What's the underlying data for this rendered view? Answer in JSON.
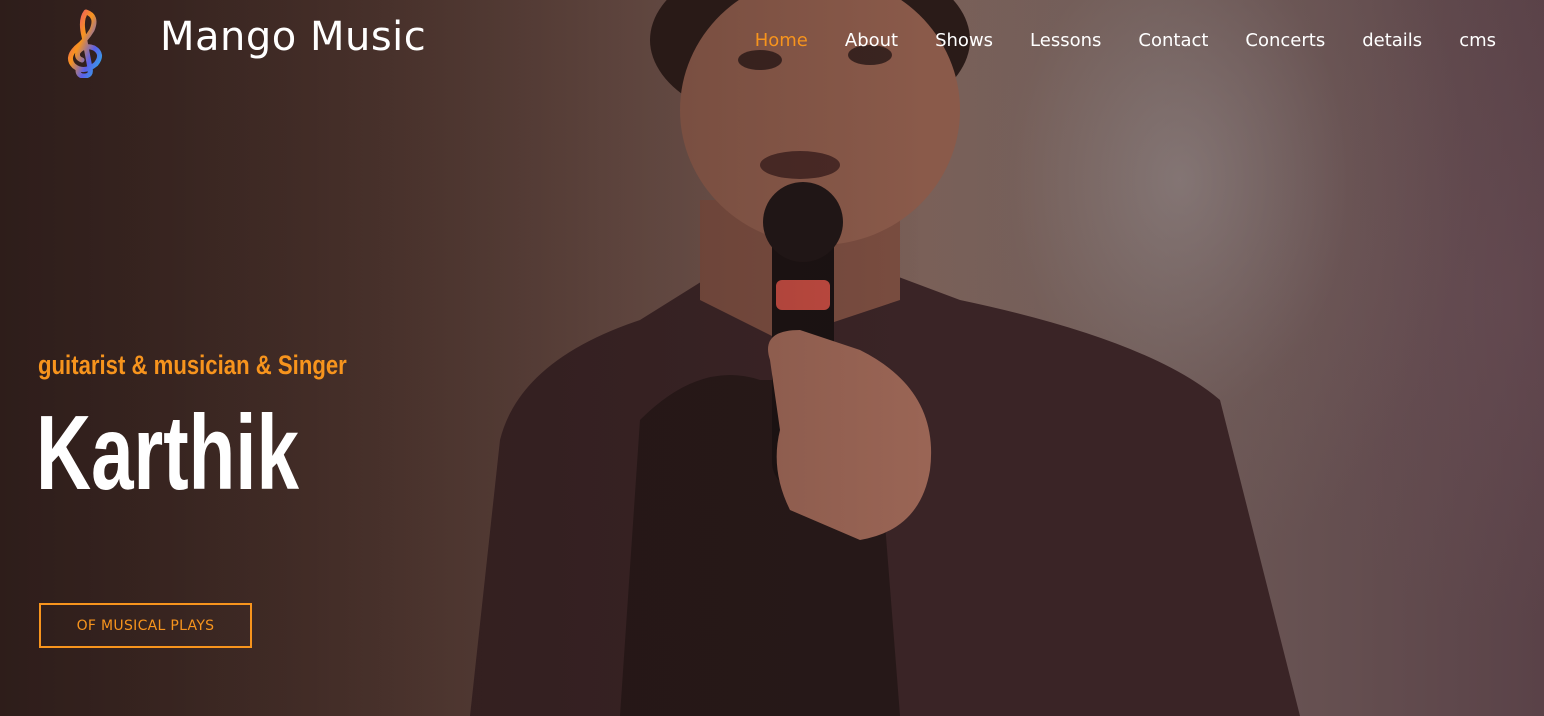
{
  "brand": {
    "name": "Mango Music",
    "logo_icon": "treble-clef-icon",
    "logo_colors": [
      "#e8398d",
      "#f7941d",
      "#5b5fe8",
      "#2ab3e6"
    ]
  },
  "nav": {
    "items": [
      {
        "label": "Home",
        "active": true
      },
      {
        "label": "About",
        "active": false
      },
      {
        "label": "Shows",
        "active": false
      },
      {
        "label": "Lessons",
        "active": false
      },
      {
        "label": "Contact",
        "active": false
      },
      {
        "label": "Concerts",
        "active": false
      },
      {
        "label": "details",
        "active": false
      },
      {
        "label": "cms",
        "active": false
      }
    ]
  },
  "hero": {
    "subtitle": "guitarist & musician & Singer",
    "title": "Karthik",
    "cta_label": "OF MUSICAL PLAYS"
  },
  "colors": {
    "accent": "#f7941d",
    "text": "#ffffff"
  }
}
